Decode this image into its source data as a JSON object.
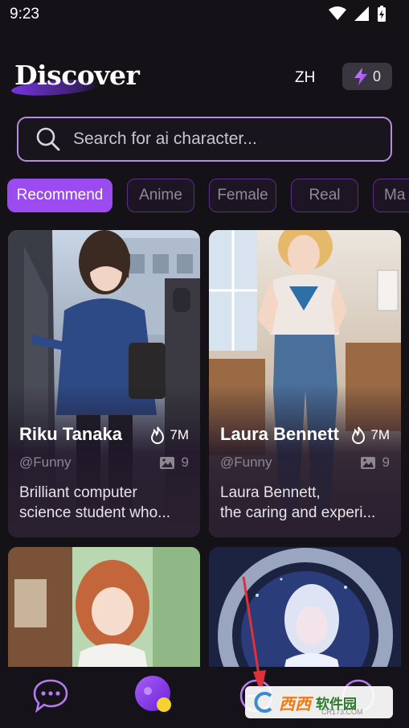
{
  "status": {
    "time": "9:23"
  },
  "header": {
    "title": "Discover",
    "language": "ZH",
    "energy_count": "0"
  },
  "search": {
    "placeholder": "Search for ai character..."
  },
  "categories": [
    "Recommend",
    "Anime",
    "Female",
    "Real",
    "Ma"
  ],
  "cards": [
    {
      "name": "Riku Tanaka",
      "views": "7M",
      "author": "@Funny",
      "images": "9",
      "desc_line1": "Brilliant computer",
      "desc_line2": "science student who..."
    },
    {
      "name": "Laura Bennett",
      "views": "7M",
      "author": "@Funny",
      "images": "9",
      "desc_line1": "Laura Bennett,",
      "desc_line2": "the caring and experi..."
    }
  ],
  "tabbar": {
    "items": [
      "chat-icon",
      "discover-icon",
      "create-icon",
      "profile-icon"
    ]
  },
  "watermark": {
    "brand": "西西",
    "cn": "软件园",
    "domain": "CR173.COM"
  },
  "colors": {
    "accent": "#9b4bf0",
    "background": "#141117",
    "search_border": "#b88be0"
  }
}
